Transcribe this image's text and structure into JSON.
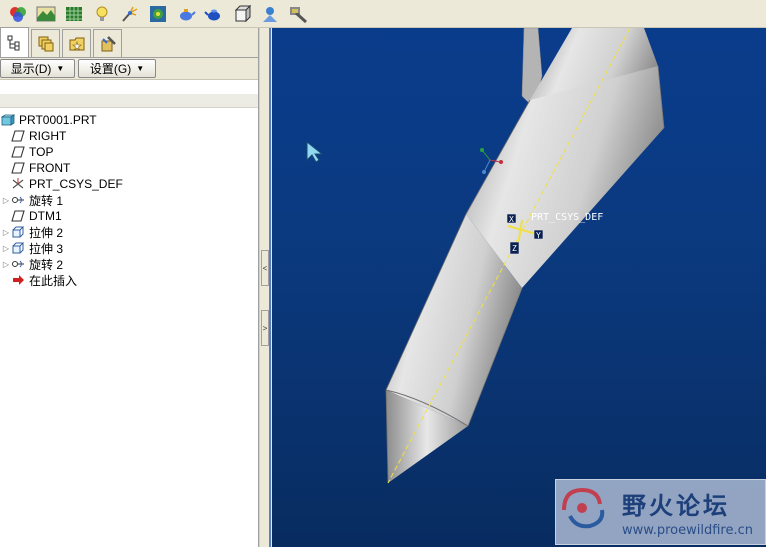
{
  "toolbar": {
    "icons": [
      "color-appearance-icon",
      "terrain-icon",
      "texture-icon",
      "light-bulb-icon",
      "light-effects-icon",
      "scene-icon",
      "teapot-render-icon",
      "blue-teapot-icon",
      "shade-box-icon",
      "perspective-icon",
      "render-tool-icon"
    ]
  },
  "panel": {
    "tabs": [
      "model-tree-tab",
      "layers-tab",
      "favorites-tab",
      "tools-tab"
    ],
    "show_label": "显示(D)",
    "settings_label": "设置(G)"
  },
  "tree": {
    "root": "PRT0001.PRT",
    "items": [
      {
        "label": "RIGHT",
        "icon": "datum-plane-icon",
        "expandable": false
      },
      {
        "label": "TOP",
        "icon": "datum-plane-icon",
        "expandable": false
      },
      {
        "label": "FRONT",
        "icon": "datum-plane-icon",
        "expandable": false
      },
      {
        "label": "PRT_CSYS_DEF",
        "icon": "csys-icon",
        "expandable": false
      },
      {
        "label": "旋转 1",
        "icon": "revolve-icon",
        "expandable": true
      },
      {
        "label": "DTM1",
        "icon": "datum-plane-icon",
        "expandable": false
      },
      {
        "label": "拉伸 2",
        "icon": "extrude-icon",
        "expandable": true
      },
      {
        "label": "拉伸 3",
        "icon": "extrude-icon",
        "expandable": true
      },
      {
        "label": "旋转 2",
        "icon": "revolve-icon",
        "expandable": true
      },
      {
        "label": "在此插入",
        "icon": "insert-arrow-icon",
        "expandable": false
      }
    ]
  },
  "viewport": {
    "csys_label": "PRT_CSYS_DEF",
    "axis_x": "X",
    "axis_y": "Y",
    "axis_z": "Z"
  },
  "watermark": {
    "title": "野火论坛",
    "subtitle": "www.proewildfire.cn"
  },
  "colors": {
    "viewport_top": "#0a3c8c",
    "viewport_bottom": "#082c60",
    "model_gray": "#c8c8c8",
    "axis_line": "#f0e040",
    "panel_bg": "#ece9d8"
  }
}
